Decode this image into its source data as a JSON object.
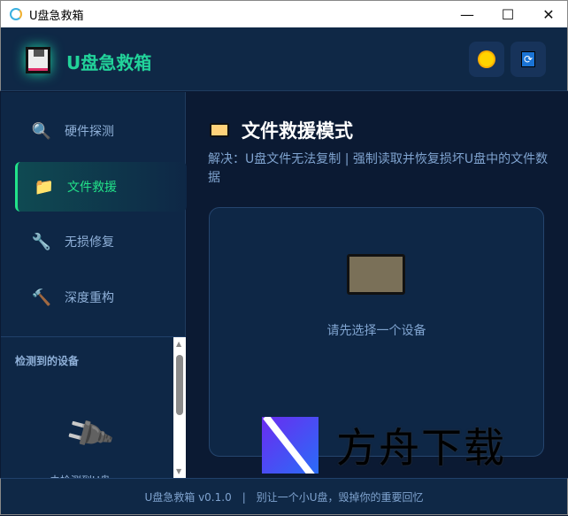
{
  "window": {
    "title": "U盘急救箱"
  },
  "header": {
    "brand": "U盘急救箱",
    "theme_icon": "sun-icon",
    "refresh_icon": "refresh-icon"
  },
  "sidebar": {
    "items": [
      {
        "label": "硬件探测",
        "icon": "🔍"
      },
      {
        "label": "文件救援",
        "icon": "📁",
        "active": true
      },
      {
        "label": "无损修复",
        "icon": "🔧"
      },
      {
        "label": "深度重构",
        "icon": "🔨"
      }
    ],
    "devices_title": "检测到的设备",
    "no_device": "未检测到U盘"
  },
  "main": {
    "title": "文件救援模式",
    "description": "解决：U盘文件无法复制 | 强制读取并恢复损坏U盘中的文件数据",
    "hint": "请先选择一个设备"
  },
  "footer": {
    "text": "U盘急救箱 v0.1.0　|　别让一个小U盘，毁掉你的重要回忆"
  },
  "watermark": {
    "text": "方舟下载"
  },
  "colors": {
    "accent": "#22d39a",
    "bg": "#0b1a33",
    "panel": "#0e2746"
  }
}
